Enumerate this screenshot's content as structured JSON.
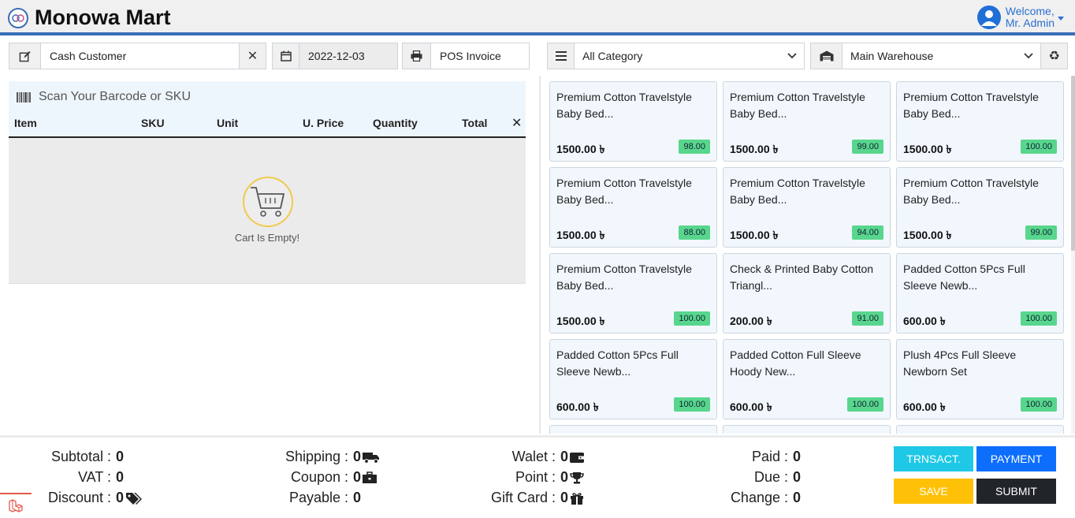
{
  "header": {
    "brand_name": "Monowa Mart",
    "welcome_line1": "Welcome,",
    "welcome_line2": "Mr. Admin"
  },
  "toolbar": {
    "customer": "Cash Customer",
    "date": "2022-12-03",
    "invoice_type": "POS Invoice",
    "category": "All Category",
    "warehouse": "Main Warehouse"
  },
  "cart": {
    "scan_placeholder": "Scan Your Barcode or SKU",
    "columns": [
      "Item",
      "SKU",
      "Unit",
      "U. Price",
      "Quantity",
      "Total"
    ],
    "remove_all_symbol": "✕",
    "empty_text": "Cart Is Empty!"
  },
  "products": [
    {
      "name": "Premium Cotton Travelstyle Baby Bed...",
      "price": "1500.00 ৳",
      "stock": "98.00"
    },
    {
      "name": "Premium Cotton Travelstyle Baby Bed...",
      "price": "1500.00 ৳",
      "stock": "99.00"
    },
    {
      "name": "Premium Cotton Travelstyle Baby Bed...",
      "price": "1500.00 ৳",
      "stock": "100.00"
    },
    {
      "name": "Premium Cotton Travelstyle Baby Bed...",
      "price": "1500.00 ৳",
      "stock": "88.00"
    },
    {
      "name": "Premium Cotton Travelstyle Baby Bed...",
      "price": "1500.00 ৳",
      "stock": "94.00"
    },
    {
      "name": "Premium Cotton Travelstyle Baby Bed...",
      "price": "1500.00 ৳",
      "stock": "99.00"
    },
    {
      "name": "Premium Cotton Travelstyle Baby Bed...",
      "price": "1500.00 ৳",
      "stock": "100.00"
    },
    {
      "name": "Check & Printed Baby Cotton Triangl...",
      "price": "200.00 ৳",
      "stock": "91.00"
    },
    {
      "name": "Padded Cotton 5Pcs Full Sleeve Newb...",
      "price": "600.00 ৳",
      "stock": "100.00"
    },
    {
      "name": "Padded Cotton 5Pcs Full Sleeve Newb...",
      "price": "600.00 ৳",
      "stock": "100.00"
    },
    {
      "name": "Padded Cotton Full Sleeve Hoody New...",
      "price": "600.00 ৳",
      "stock": "100.00"
    },
    {
      "name": "Plush 4Pcs Full Sleeve Newborn Set",
      "price": "600.00 ৳",
      "stock": "100.00"
    },
    {
      "name": "",
      "price": "",
      "stock": ""
    },
    {
      "name": "",
      "price": "",
      "stock": ""
    },
    {
      "name": "",
      "price": "",
      "stock": ""
    }
  ],
  "summary": {
    "subtotal_label": "Subtotal :",
    "subtotal": "0",
    "vat_label": "VAT :",
    "vat": "0",
    "discount_label": "Discount :",
    "discount": "0",
    "shipping_label": "Shipping :",
    "shipping": "0",
    "coupon_label": "Coupon :",
    "coupon": "0",
    "payable_label": "Payable :",
    "payable": "0",
    "wallet_label": "Walet :",
    "wallet": "0",
    "point_label": "Point :",
    "point": "0",
    "giftcard_label": "Gift Card :",
    "giftcard": "0",
    "paid_label": "Paid :",
    "paid": "0",
    "due_label": "Due :",
    "due": "0",
    "change_label": "Change :",
    "change": "0"
  },
  "buttons": {
    "transaction": "TRNSACT.",
    "payment": "PAYMENT",
    "save": "SAVE",
    "submit": "SUBMIT"
  },
  "colors": {
    "accent": "#3b6fb6",
    "stock_badge": "#58d68d",
    "transaction_btn": "#1ec8e6",
    "payment_btn": "#0d6efd",
    "save_btn": "#ffc107",
    "submit_btn": "#212529"
  },
  "icons": {
    "customer": "edit-icon",
    "date": "calendar-icon",
    "invoice": "printer-icon",
    "category": "list-icon",
    "warehouse": "warehouse-icon",
    "reset": "recycle-icon",
    "scan": "barcode-icon",
    "empty_cart": "cart-icon"
  }
}
